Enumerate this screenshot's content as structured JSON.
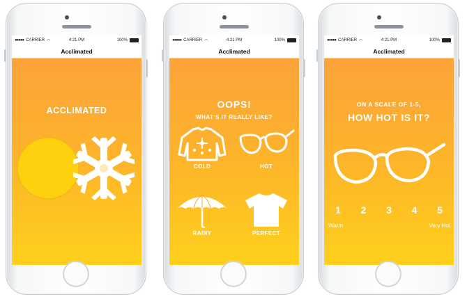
{
  "status_bar": {
    "carrier": "CARRIER",
    "time": "4:21 PM",
    "battery": "100%"
  },
  "nav": {
    "title": "Acclimated"
  },
  "screen1": {
    "title": "ACCLIMATED",
    "icons": [
      "sun-icon",
      "snowflake-icon"
    ]
  },
  "screen2": {
    "title": "OOPS!",
    "subtitle": "WHAT'S IT REALLY LIKE?",
    "options": [
      {
        "label": "COLD",
        "icon": "sweater-icon"
      },
      {
        "label": "HOT",
        "icon": "sunglasses-icon"
      },
      {
        "label": "RAINY",
        "icon": "umbrella-icon"
      },
      {
        "label": "PERFECT",
        "icon": "tshirt-icon"
      }
    ]
  },
  "screen3": {
    "title_line1": "ON A SCALE OF 1-5,",
    "title_line2": "HOW HOT IS IT?",
    "icon": "sunglasses-icon",
    "scale": [
      "1",
      "2",
      "3",
      "4",
      "5"
    ],
    "min_label": "Warm",
    "max_label": "Very Hot"
  },
  "colors": {
    "gradient_top": "#fca33a",
    "gradient_bottom": "#fed01c",
    "sun": "#fdd10d",
    "sun_edge": "#f2b81c",
    "foreground": "#ffffff"
  }
}
